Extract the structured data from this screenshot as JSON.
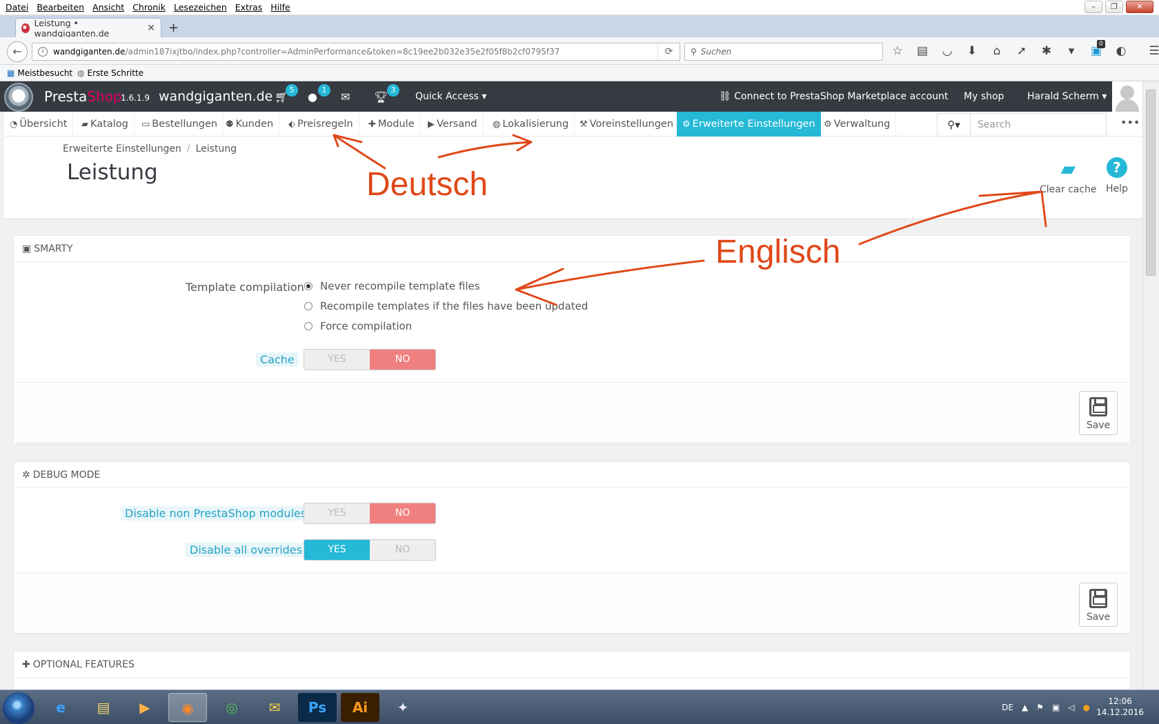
{
  "browser": {
    "menu": [
      "Datei",
      "Bearbeiten",
      "Ansicht",
      "Chronik",
      "Lesezeichen",
      "Extras",
      "Hilfe"
    ],
    "tab_title": "Leistung • wandgiganten.de",
    "url_host": "wandgiganten.de",
    "url_path": "/admin187ixjtbo/index.php?controller=AdminPerformance&token=8c19ee2b032e35e2f05f8b2cf0795f37",
    "search_placeholder": "Suchen",
    "bookmarks": [
      "Meistbesucht",
      "Erste Schritte"
    ],
    "notification_count": "0"
  },
  "header": {
    "brand_presta": "Presta",
    "brand_shop": "Shop",
    "version": "1.6.1.9",
    "shop_name": "wandgiganten.de",
    "badges": {
      "cart": "5",
      "customers": "1",
      "trophy": "3"
    },
    "quick_access": "Quick Access",
    "connect": "Connect to PrestaShop Marketplace account",
    "my_shop": "My shop",
    "user": "Harald Scherm"
  },
  "nav": {
    "items": [
      "Übersicht",
      "Katalog",
      "Bestellungen",
      "Kunden",
      "Preisregeln",
      "Module",
      "Versand",
      "Lokalisierung",
      "Voreinstellungen",
      "Erweiterte Einstellungen",
      "Verwaltung"
    ],
    "search_placeholder": "Search"
  },
  "page": {
    "breadcrumb": [
      "Erweiterte Einstellungen",
      "Leistung"
    ],
    "title": "Leistung",
    "toolbar": {
      "clear_cache": "Clear cache",
      "help": "Help"
    }
  },
  "smarty": {
    "title": "SMARTY",
    "template_label": "Template compilation",
    "options": [
      "Never recompile template files",
      "Recompile templates if the files have been updated",
      "Force compilation"
    ],
    "selected": 0,
    "cache_label": "Cache",
    "save": "Save"
  },
  "debug": {
    "title": "DEBUG MODE",
    "disable_modules": "Disable non PrestaShop modules",
    "disable_overrides": "Disable all overrides",
    "save": "Save"
  },
  "optional": {
    "title": "OPTIONAL FEATURES"
  },
  "switch": {
    "yes": "YES",
    "no": "NO"
  },
  "annotations": {
    "deutsch": "Deutsch",
    "englisch": "Englisch"
  },
  "taskbar": {
    "lang": "DE",
    "time": "12:06",
    "date": "14.12.2016"
  },
  "colors": {
    "accent": "#25b9d7",
    "header": "#363a41",
    "switch_no": "#f08080",
    "annotation": "#e04818",
    "brand_pink": "#df0067"
  }
}
